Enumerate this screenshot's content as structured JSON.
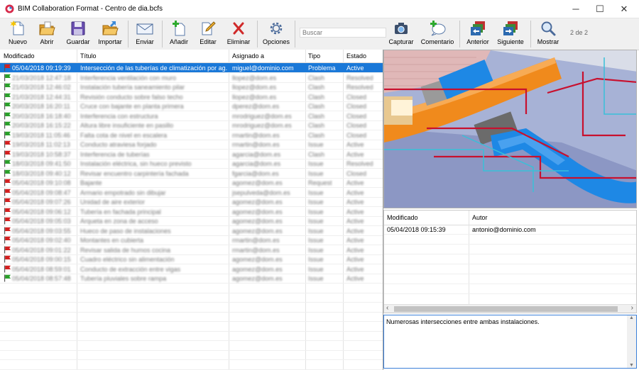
{
  "window": {
    "title": "BIM Collaboration Format - Centro de dia.bcfs",
    "minimize": "─",
    "maximize": "☐",
    "close": "✕"
  },
  "toolbar": {
    "nuevo": "Nuevo",
    "abrir": "Abrir",
    "guardar": "Guardar",
    "importar": "Importar",
    "enviar": "Enviar",
    "anadir": "Añadir",
    "editar": "Editar",
    "eliminar": "Eliminar",
    "opciones": "Opciones",
    "search_label": "Buscar",
    "capturar": "Capturar",
    "comentario": "Comentario",
    "anterior": "Anterior",
    "siguiente": "Siguiente",
    "mostrar": "Mostrar",
    "page_indicator": "2 de 2"
  },
  "issues": {
    "headers": {
      "modificado": "Modificado",
      "titulo": "Título",
      "asignado": "Asignado a",
      "tipo": "Tipo",
      "estado": "Estado"
    },
    "rows": [
      {
        "flag": "red",
        "modificado": "05/04/2018 09:19:39",
        "titulo": "Intersección de las tuberías de climatización por ag...",
        "asignado": "miguel@dominio.com",
        "tipo": "Problema",
        "estado": "Active",
        "selected": true
      },
      {
        "flag": "green",
        "modificado": "21/03/2018 12:47:18",
        "titulo": "Interferencia ventilación con muro",
        "asignado": "llopez@dom.es",
        "tipo": "Clash",
        "estado": "Resolved",
        "selected": false,
        "blurred": true
      },
      {
        "flag": "green",
        "modificado": "21/03/2018 12:46:02",
        "titulo": "Instalación tubería saneamiento pilar",
        "asignado": "llopez@dom.es",
        "tipo": "Clash",
        "estado": "Resolved",
        "selected": false,
        "blurred": true
      },
      {
        "flag": "green",
        "modificado": "21/03/2018 12:44:31",
        "titulo": "Revisión conducto sobre falso techo",
        "asignado": "llopez@dom.es",
        "tipo": "Clash",
        "estado": "Closed",
        "selected": false,
        "blurred": true
      },
      {
        "flag": "green",
        "modificado": "20/03/2018 16:20:11",
        "titulo": "Cruce con bajante en planta primera",
        "asignado": "dperez@dom.es",
        "tipo": "Clash",
        "estado": "Closed",
        "selected": false,
        "blurred": true
      },
      {
        "flag": "green",
        "modificado": "20/03/2018 16:18:40",
        "titulo": "Interferencia con estructura",
        "asignado": "mrodriguez@dom.es",
        "tipo": "Clash",
        "estado": "Closed",
        "selected": false,
        "blurred": true
      },
      {
        "flag": "green",
        "modificado": "20/03/2018 16:15:22",
        "titulo": "Altura libre insuficiente en pasillo",
        "asignado": "mrodriguez@dom.es",
        "tipo": "Clash",
        "estado": "Closed",
        "selected": false,
        "blurred": true
      },
      {
        "flag": "green",
        "modificado": "19/03/2018 11:05:46",
        "titulo": "Falta cota de nivel en escalera",
        "asignado": "rmartin@dom.es",
        "tipo": "Clash",
        "estado": "Closed",
        "selected": false,
        "blurred": true
      },
      {
        "flag": "red",
        "modificado": "19/03/2018 11:02:13",
        "titulo": "Conducto atraviesa forjado",
        "asignado": "rmartin@dom.es",
        "tipo": "Issue",
        "estado": "Active",
        "selected": false,
        "blurred": true
      },
      {
        "flag": "red",
        "modificado": "19/03/2018 10:58:37",
        "titulo": "Interferencia de tuberías",
        "asignado": "agarcia@dom.es",
        "tipo": "Clash",
        "estado": "Active",
        "selected": false,
        "blurred": true
      },
      {
        "flag": "green",
        "modificado": "18/03/2018 09:41:50",
        "titulo": "Instalación eléctrica, sin hueco previsto",
        "asignado": "agarcia@dom.es",
        "tipo": "Issue",
        "estado": "Resolved",
        "selected": false,
        "blurred": true
      },
      {
        "flag": "green",
        "modificado": "18/03/2018 09:40:12",
        "titulo": "Revisar encuentro carpintería fachada",
        "asignado": "fgarcia@dom.es",
        "tipo": "Issue",
        "estado": "Closed",
        "selected": false,
        "blurred": true
      },
      {
        "flag": "red",
        "modificado": "05/04/2018 09:10:08",
        "titulo": "Bajante",
        "asignado": "agomez@dom.es",
        "tipo": "Request",
        "estado": "Active",
        "selected": false,
        "blurred": true
      },
      {
        "flag": "red",
        "modificado": "05/04/2018 09:08:47",
        "titulo": "Armario empotrado sin dibujar",
        "asignado": "jsepulveda@dom.es",
        "tipo": "Issue",
        "estado": "Active",
        "selected": false,
        "blurred": true
      },
      {
        "flag": "red",
        "modificado": "05/04/2018 09:07:26",
        "titulo": "Unidad de aire exterior",
        "asignado": "agomez@dom.es",
        "tipo": "Issue",
        "estado": "Active",
        "selected": false,
        "blurred": true
      },
      {
        "flag": "red",
        "modificado": "05/04/2018 09:06:12",
        "titulo": "Tubería en fachada principal",
        "asignado": "agomez@dom.es",
        "tipo": "Issue",
        "estado": "Active",
        "selected": false,
        "blurred": true
      },
      {
        "flag": "red",
        "modificado": "05/04/2018 09:05:03",
        "titulo": "Arqueta en zona de acceso",
        "asignado": "agomez@dom.es",
        "tipo": "Issue",
        "estado": "Active",
        "selected": false,
        "blurred": true
      },
      {
        "flag": "red",
        "modificado": "05/04/2018 09:03:55",
        "titulo": "Hueco de paso de instalaciones",
        "asignado": "agomez@dom.es",
        "tipo": "Issue",
        "estado": "Active",
        "selected": false,
        "blurred": true
      },
      {
        "flag": "red",
        "modificado": "05/04/2018 09:02:40",
        "titulo": "Montantes en cubierta",
        "asignado": "rmartin@dom.es",
        "tipo": "Issue",
        "estado": "Active",
        "selected": false,
        "blurred": true
      },
      {
        "flag": "red",
        "modificado": "05/04/2018 09:01:22",
        "titulo": "Revisar salida de humos cocina",
        "asignado": "rmartin@dom.es",
        "tipo": "Issue",
        "estado": "Active",
        "selected": false,
        "blurred": true
      },
      {
        "flag": "red",
        "modificado": "05/04/2018 09:00:15",
        "titulo": "Cuadro eléctrico sin alimentación",
        "asignado": "agomez@dom.es",
        "tipo": "Issue",
        "estado": "Active",
        "selected": false,
        "blurred": true
      },
      {
        "flag": "red",
        "modificado": "05/04/2018 08:59:01",
        "titulo": "Conducto de extracción entre vigas",
        "asignado": "agomez@dom.es",
        "tipo": "Issue",
        "estado": "Active",
        "selected": false,
        "blurred": true
      },
      {
        "flag": "green",
        "modificado": "05/04/2018 08:57:48",
        "titulo": "Tubería pluviales sobre rampa",
        "asignado": "agomez@dom.es",
        "tipo": "Issue",
        "estado": "Active",
        "selected": false,
        "blurred": true
      }
    ]
  },
  "comments": {
    "headers": {
      "modificado": "Modificado",
      "autor": "Autor"
    },
    "rows": [
      {
        "modificado": "05/04/2018 09:15:39",
        "autor": "antonio@dominio.com"
      }
    ]
  },
  "description": "Numerosas intersecciones entre ambas instalaciones.",
  "colors": {
    "accent": "#1a78d8",
    "flag_red": "#d32020",
    "flag_green": "#2aa02a",
    "duct_orange": "#f08a1c",
    "duct_blue": "#1e88e5",
    "pipe_red": "#c8102e"
  }
}
